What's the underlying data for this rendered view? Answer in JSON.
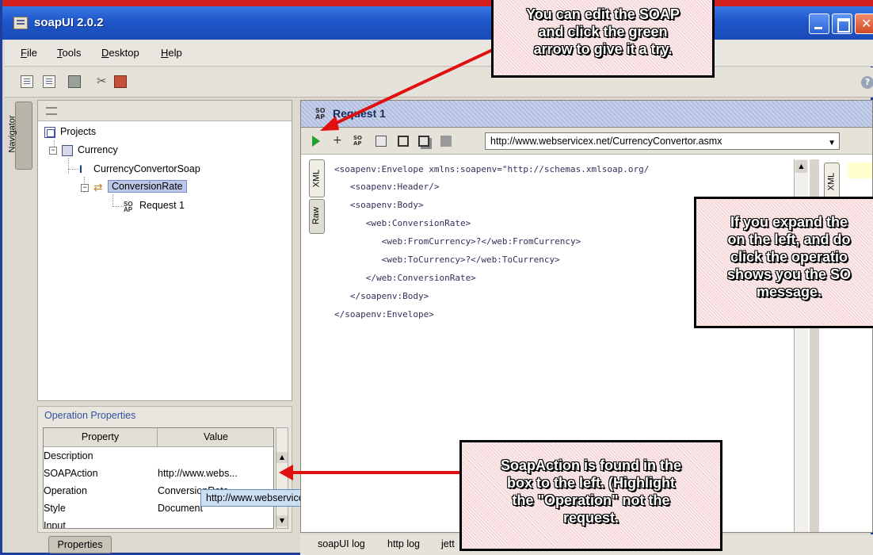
{
  "window": {
    "title": "soapUI 2.0.2"
  },
  "menu": {
    "items": [
      "File",
      "Tools",
      "Desktop",
      "Help"
    ]
  },
  "navigator": {
    "tab_label": "Navigator",
    "tree": {
      "projects": "Projects",
      "project": "Currency",
      "interface": "CurrencyConvertorSoap",
      "operation": "ConversionRate",
      "request": "Request 1"
    }
  },
  "operation_properties": {
    "title": "Operation Properties",
    "columns": [
      "Property",
      "Value"
    ],
    "rows": [
      {
        "property": "Description",
        "value": ""
      },
      {
        "property": "SOAPAction",
        "value": "http://www.webs..."
      },
      {
        "property": "Operation",
        "value": "ConversionRate"
      },
      {
        "property": "Style",
        "value": "Document"
      },
      {
        "property": "Input",
        "value": ""
      }
    ],
    "tooltip": "http://www.webserviceX.NET/ConversionRate",
    "bottom_button": "Properties"
  },
  "request": {
    "title": "Request 1",
    "title_icon": "SO AP",
    "url": "http://www.webservicex.net/CurrencyConvertor.asmx",
    "tabs": {
      "xml": "XML",
      "raw": "Raw",
      "response_xml": "XML"
    },
    "code_lines": [
      "<soapenv:Envelope xmlns:soapenv=\"http://schemas.xmlsoap.org/",
      "   <soapenv:Header/>",
      "   <soapenv:Body>",
      "      <web:ConversionRate>",
      "         <web:FromCurrency>?</web:FromCurrency>",
      "         <web:ToCurrency>?</web:ToCurrency>",
      "      </web:ConversionRate>",
      "   </soapenv:Body>",
      "</soapenv:Envelope>"
    ]
  },
  "logs": {
    "tabs": [
      "soapUI log",
      "http log",
      "jett"
    ]
  },
  "callouts": {
    "top": [
      "You can edit the SOAP",
      "and click the green",
      "arrow to give it a try."
    ],
    "right": [
      "If you expand the",
      "on the left, and do",
      "click the operatio",
      "shows you the SO",
      "message."
    ],
    "bottom": [
      "SoapAction is found in the",
      "box to the left.  (Highlight",
      "the \"Operation\" not the",
      "request."
    ]
  },
  "colors": {
    "titlebar": "#1e55c8",
    "accent_red": "#e01010",
    "run_arrow": "#20a030",
    "callout_fill": "#f3cdd0"
  }
}
